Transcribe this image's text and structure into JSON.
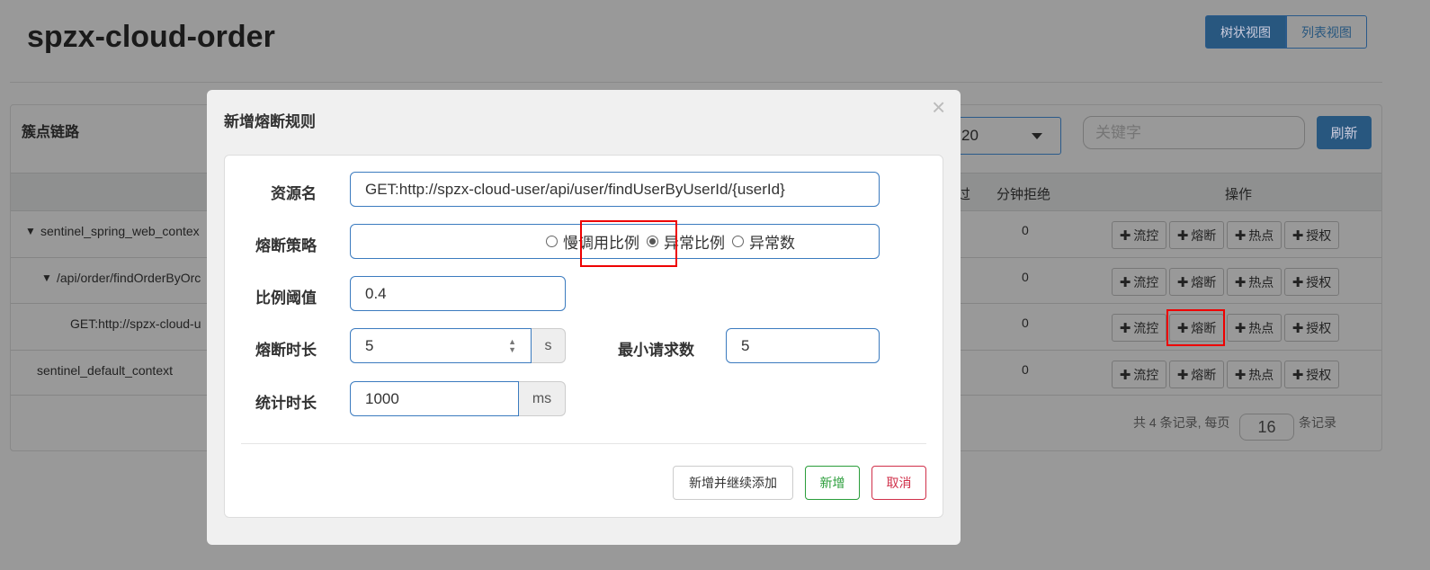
{
  "page": {
    "title": "spzx-cloud-order",
    "view_buttons": [
      "树状视图",
      "列表视图"
    ]
  },
  "panel": {
    "title": "簇点链路",
    "select_value": "20",
    "keyword_placeholder": "关键字",
    "refresh": "刷新",
    "headers": {
      "pass": "过",
      "reject": "分钟拒绝",
      "ops": "操作"
    },
    "rows": [
      {
        "name": "sentinel_spring_web_contex",
        "reject": "0",
        "expand": true,
        "indent": 0
      },
      {
        "name": "/api/order/findOrderByOrc",
        "reject": "0",
        "expand": true,
        "indent": 1
      },
      {
        "name": "GET:http://spzx-cloud-u",
        "reject": "0",
        "expand": false,
        "indent": 2
      },
      {
        "name": "sentinel_default_context",
        "reject": "0",
        "expand": false,
        "indent": 0
      }
    ],
    "op_buttons": [
      "流控",
      "熔断",
      "热点",
      "授权"
    ],
    "pager": {
      "prefix": "共 4 条记录, 每页",
      "page_size": "16",
      "suffix": "条记录"
    }
  },
  "modal": {
    "title": "新增熔断规则",
    "close": "×",
    "resource_label": "资源名",
    "resource_value": "GET:http://spzx-cloud-user/api/user/findUserByUserId/{userId}",
    "strategy_label": "熔断策略",
    "strategies": [
      {
        "label": "慢调用比例",
        "checked": false
      },
      {
        "label": "异常比例",
        "checked": true
      },
      {
        "label": "异常数",
        "checked": false
      }
    ],
    "ratio_label": "比例阈值",
    "ratio_value": "0.4",
    "duration_label": "熔断时长",
    "duration_value": "5",
    "duration_unit": "s",
    "min_req_label": "最小请求数",
    "min_req_value": "5",
    "stat_label": "统计时长",
    "stat_value": "1000",
    "stat_unit": "ms",
    "buttons": {
      "add_continue": "新增并继续添加",
      "add": "新增",
      "cancel": "取消"
    }
  },
  "colors": {
    "primary": "#28577f",
    "success": "#2a9d3a",
    "danger": "#d0304a",
    "highlight": "#e00000"
  }
}
